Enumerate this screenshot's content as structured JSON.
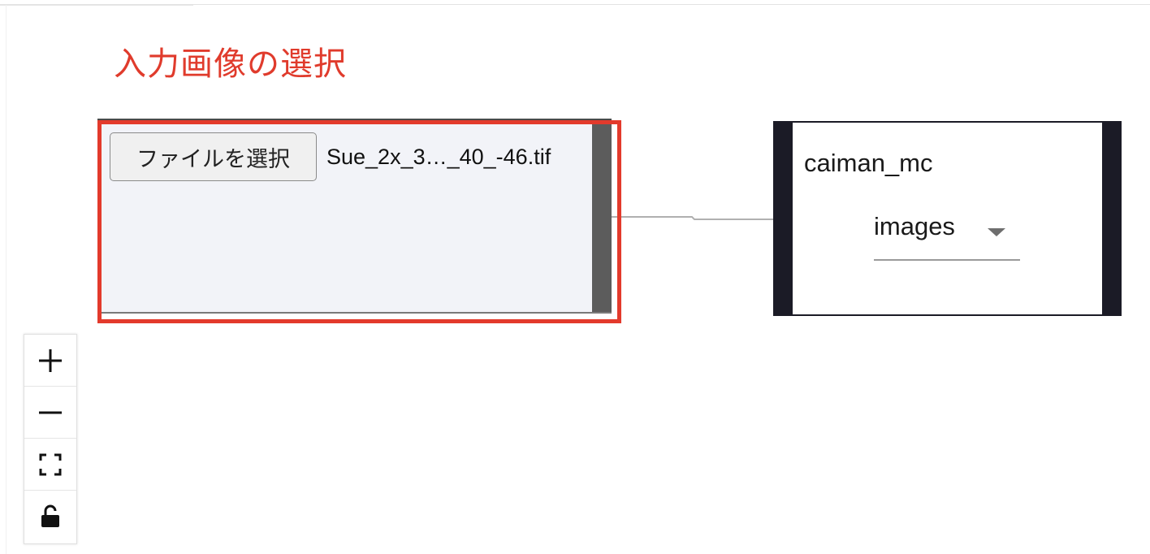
{
  "annotation": {
    "title": "入力画像の選択"
  },
  "input_node": {
    "file_button_label": "ファイルを選択",
    "file_name": "Sue_2x_3…_40_-46.tif"
  },
  "algo_node": {
    "title": "caiman_mc",
    "select_value": "images"
  },
  "controls": {
    "zoom_in_icon": "plus-icon",
    "zoom_out_icon": "minus-icon",
    "fit_view_icon": "fit-view-icon",
    "lock_icon": "unlock-icon"
  },
  "colors": {
    "highlight": "#e33a2c",
    "annotation_text": "#e03b2c",
    "node_dark": "#1b1b26",
    "input_bg": "#f2f3f8"
  }
}
